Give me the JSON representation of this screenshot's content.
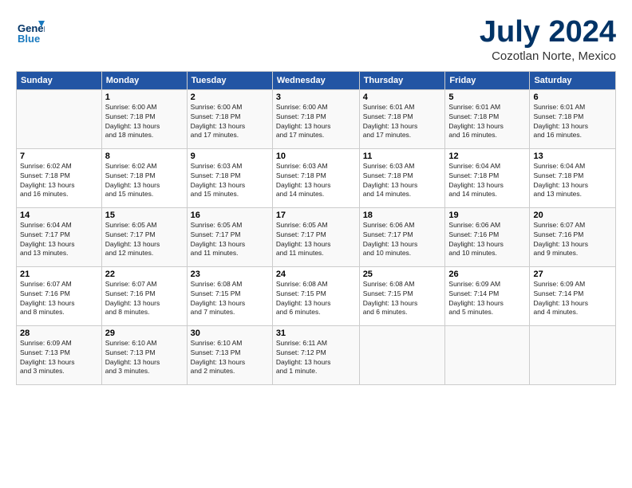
{
  "header": {
    "logo_line1": "General",
    "logo_line2": "Blue",
    "month": "July 2024",
    "location": "Cozotlan Norte, Mexico"
  },
  "days_of_week": [
    "Sunday",
    "Monday",
    "Tuesday",
    "Wednesday",
    "Thursday",
    "Friday",
    "Saturday"
  ],
  "weeks": [
    [
      {
        "day": "",
        "info": ""
      },
      {
        "day": "1",
        "info": "Sunrise: 6:00 AM\nSunset: 7:18 PM\nDaylight: 13 hours\nand 18 minutes."
      },
      {
        "day": "2",
        "info": "Sunrise: 6:00 AM\nSunset: 7:18 PM\nDaylight: 13 hours\nand 17 minutes."
      },
      {
        "day": "3",
        "info": "Sunrise: 6:00 AM\nSunset: 7:18 PM\nDaylight: 13 hours\nand 17 minutes."
      },
      {
        "day": "4",
        "info": "Sunrise: 6:01 AM\nSunset: 7:18 PM\nDaylight: 13 hours\nand 17 minutes."
      },
      {
        "day": "5",
        "info": "Sunrise: 6:01 AM\nSunset: 7:18 PM\nDaylight: 13 hours\nand 16 minutes."
      },
      {
        "day": "6",
        "info": "Sunrise: 6:01 AM\nSunset: 7:18 PM\nDaylight: 13 hours\nand 16 minutes."
      }
    ],
    [
      {
        "day": "7",
        "info": "Sunrise: 6:02 AM\nSunset: 7:18 PM\nDaylight: 13 hours\nand 16 minutes."
      },
      {
        "day": "8",
        "info": "Sunrise: 6:02 AM\nSunset: 7:18 PM\nDaylight: 13 hours\nand 15 minutes."
      },
      {
        "day": "9",
        "info": "Sunrise: 6:03 AM\nSunset: 7:18 PM\nDaylight: 13 hours\nand 15 minutes."
      },
      {
        "day": "10",
        "info": "Sunrise: 6:03 AM\nSunset: 7:18 PM\nDaylight: 13 hours\nand 14 minutes."
      },
      {
        "day": "11",
        "info": "Sunrise: 6:03 AM\nSunset: 7:18 PM\nDaylight: 13 hours\nand 14 minutes."
      },
      {
        "day": "12",
        "info": "Sunrise: 6:04 AM\nSunset: 7:18 PM\nDaylight: 13 hours\nand 14 minutes."
      },
      {
        "day": "13",
        "info": "Sunrise: 6:04 AM\nSunset: 7:18 PM\nDaylight: 13 hours\nand 13 minutes."
      }
    ],
    [
      {
        "day": "14",
        "info": "Sunrise: 6:04 AM\nSunset: 7:17 PM\nDaylight: 13 hours\nand 13 minutes."
      },
      {
        "day": "15",
        "info": "Sunrise: 6:05 AM\nSunset: 7:17 PM\nDaylight: 13 hours\nand 12 minutes."
      },
      {
        "day": "16",
        "info": "Sunrise: 6:05 AM\nSunset: 7:17 PM\nDaylight: 13 hours\nand 11 minutes."
      },
      {
        "day": "17",
        "info": "Sunrise: 6:05 AM\nSunset: 7:17 PM\nDaylight: 13 hours\nand 11 minutes."
      },
      {
        "day": "18",
        "info": "Sunrise: 6:06 AM\nSunset: 7:17 PM\nDaylight: 13 hours\nand 10 minutes."
      },
      {
        "day": "19",
        "info": "Sunrise: 6:06 AM\nSunset: 7:16 PM\nDaylight: 13 hours\nand 10 minutes."
      },
      {
        "day": "20",
        "info": "Sunrise: 6:07 AM\nSunset: 7:16 PM\nDaylight: 13 hours\nand 9 minutes."
      }
    ],
    [
      {
        "day": "21",
        "info": "Sunrise: 6:07 AM\nSunset: 7:16 PM\nDaylight: 13 hours\nand 8 minutes."
      },
      {
        "day": "22",
        "info": "Sunrise: 6:07 AM\nSunset: 7:16 PM\nDaylight: 13 hours\nand 8 minutes."
      },
      {
        "day": "23",
        "info": "Sunrise: 6:08 AM\nSunset: 7:15 PM\nDaylight: 13 hours\nand 7 minutes."
      },
      {
        "day": "24",
        "info": "Sunrise: 6:08 AM\nSunset: 7:15 PM\nDaylight: 13 hours\nand 6 minutes."
      },
      {
        "day": "25",
        "info": "Sunrise: 6:08 AM\nSunset: 7:15 PM\nDaylight: 13 hours\nand 6 minutes."
      },
      {
        "day": "26",
        "info": "Sunrise: 6:09 AM\nSunset: 7:14 PM\nDaylight: 13 hours\nand 5 minutes."
      },
      {
        "day": "27",
        "info": "Sunrise: 6:09 AM\nSunset: 7:14 PM\nDaylight: 13 hours\nand 4 minutes."
      }
    ],
    [
      {
        "day": "28",
        "info": "Sunrise: 6:09 AM\nSunset: 7:13 PM\nDaylight: 13 hours\nand 3 minutes."
      },
      {
        "day": "29",
        "info": "Sunrise: 6:10 AM\nSunset: 7:13 PM\nDaylight: 13 hours\nand 3 minutes."
      },
      {
        "day": "30",
        "info": "Sunrise: 6:10 AM\nSunset: 7:13 PM\nDaylight: 13 hours\nand 2 minutes."
      },
      {
        "day": "31",
        "info": "Sunrise: 6:11 AM\nSunset: 7:12 PM\nDaylight: 13 hours\nand 1 minute."
      },
      {
        "day": "",
        "info": ""
      },
      {
        "day": "",
        "info": ""
      },
      {
        "day": "",
        "info": ""
      }
    ]
  ]
}
